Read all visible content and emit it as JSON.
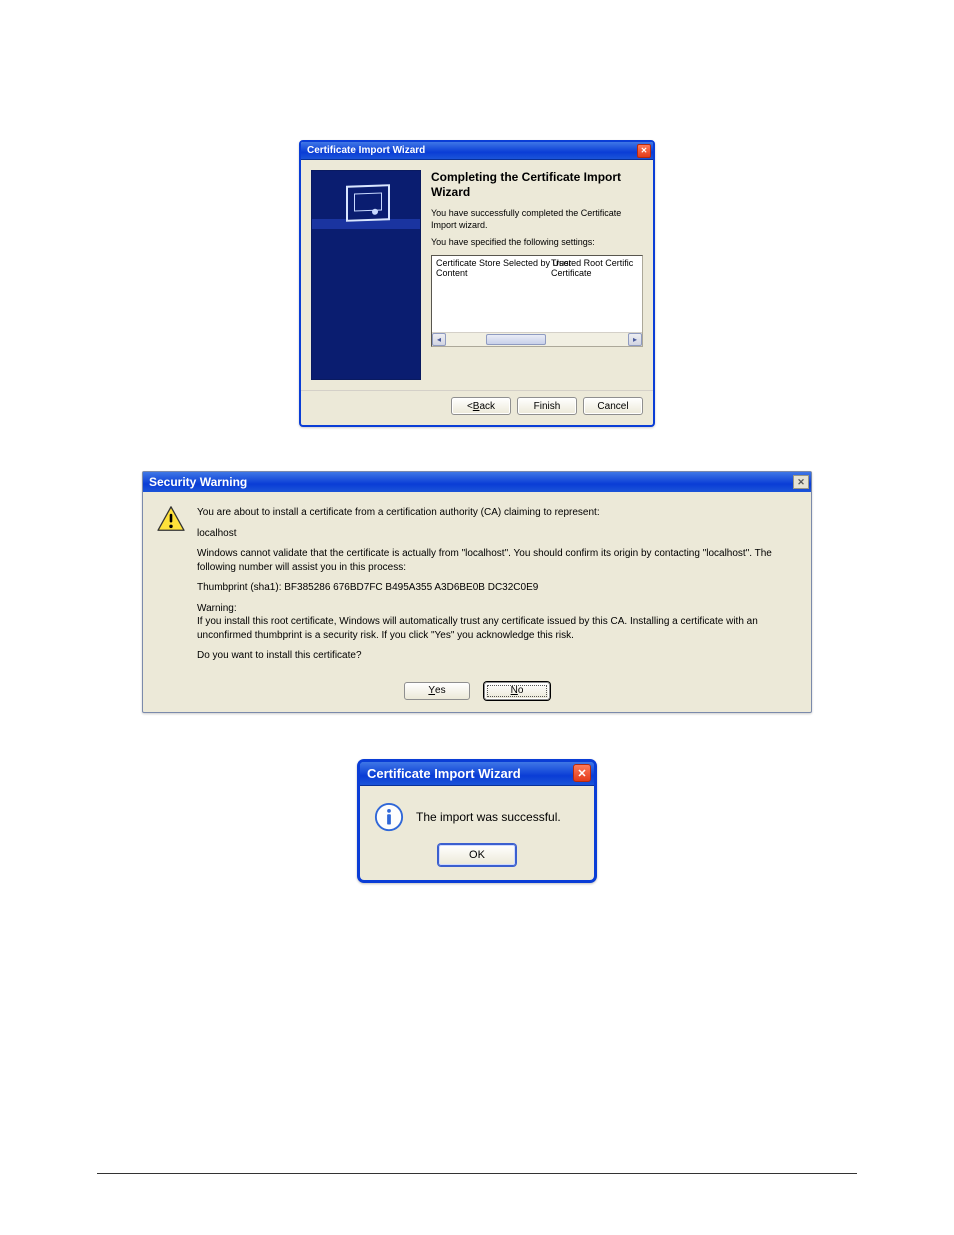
{
  "dlg1": {
    "title": "Certificate Import Wizard",
    "heading": "Completing the Certificate Import Wizard",
    "p1": "You have successfully completed the Certificate Import wizard.",
    "p2": "You have specified the following settings:",
    "list": {
      "row1": {
        "c1": "Certificate Store Selected by User",
        "c2": "Trusted Root Certific"
      },
      "row2": {
        "c1": "Content",
        "c2": "Certificate"
      }
    },
    "buttons": {
      "back": "< Back",
      "finish": "Finish",
      "cancel": "Cancel"
    }
  },
  "dlg2": {
    "title": "Security Warning",
    "p1": "You are about to install a certificate from a certification authority (CA) claiming to represent:",
    "p2": "localhost",
    "p3": "Windows cannot validate that the certificate is actually from \"localhost\". You should confirm its origin by contacting \"localhost\". The following number will assist you in this process:",
    "p4": "Thumbprint (sha1): BF385286 676BD7FC B495A355 A3D6BE0B DC32C0E9",
    "p5a": "Warning:",
    "p5b": "If you install this root certificate, Windows will automatically trust any certificate issued by this CA. Installing a certificate with an unconfirmed thumbprint is a security risk. If you click \"Yes\" you acknowledge this risk.",
    "p6": "Do you want to install this certificate?",
    "buttons": {
      "yes": "Yes",
      "no": "No"
    }
  },
  "dlg3": {
    "title": "Certificate Import Wizard",
    "message": "The import was successful.",
    "buttons": {
      "ok": "OK"
    }
  }
}
